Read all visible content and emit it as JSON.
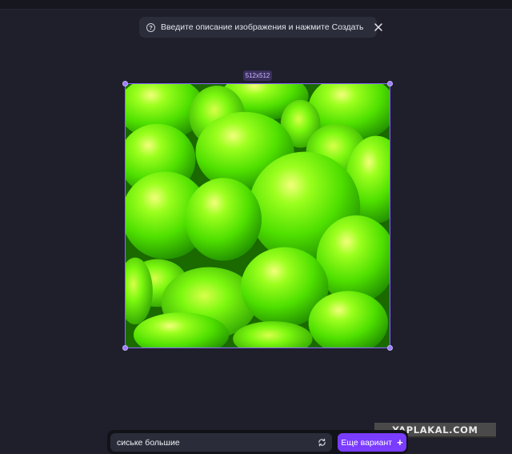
{
  "hint": {
    "text": "Введите описание изображения и нажмите Создать",
    "icon": "help-circle-icon",
    "close_icon": "close-icon"
  },
  "canvas": {
    "size_label": "512x512",
    "image_description_colors": [
      "#7bff1a",
      "#3fcf00",
      "#1a7a00"
    ]
  },
  "prompt": {
    "value": "сиське большие",
    "refresh_icon": "refresh-icon"
  },
  "variant_button": {
    "label": "Еще вариант",
    "icon": "plus-icon",
    "color": "#7a3cff"
  },
  "watermark": {
    "text": "YAPLAKAL.COM"
  }
}
